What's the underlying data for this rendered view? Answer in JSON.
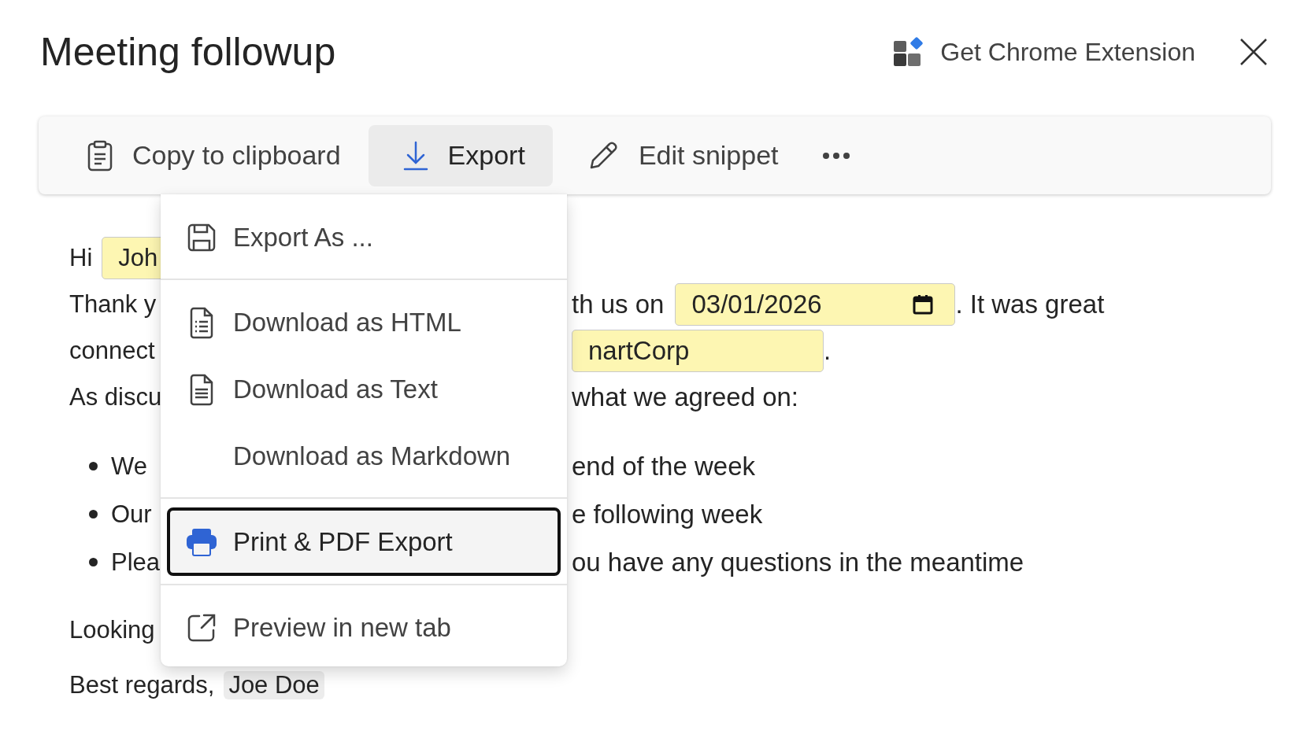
{
  "header": {
    "title": "Meeting followup",
    "extension_link": "Get Chrome Extension"
  },
  "toolbar": [
    {
      "kind": "clipboard",
      "label": "Copy to clipboard",
      "selected": false
    },
    {
      "kind": "export",
      "label": "Export",
      "selected": true
    },
    {
      "kind": "edit",
      "label": "Edit snippet",
      "selected": false
    },
    {
      "kind": "more",
      "selected": false
    }
  ],
  "export_menu": {
    "items": [
      {
        "kind": "save",
        "label": "Export As ...",
        "focused": false,
        "divider_after": true
      },
      {
        "kind": "html",
        "label": "Download as HTML",
        "focused": false,
        "divider_after": false
      },
      {
        "kind": "text",
        "label": "Download as Text",
        "focused": false,
        "divider_after": false
      },
      {
        "kind": "none",
        "label": "Download as Markdown",
        "focused": false,
        "divider_after": true
      },
      {
        "kind": "print",
        "label": "Print & PDF Export",
        "focused": true,
        "divider_after": true
      },
      {
        "kind": "external",
        "label": "Preview in new tab",
        "focused": false,
        "divider_after": false
      }
    ]
  },
  "body": [
    {
      "kind": "paragraph",
      "lines": [
        {
          "left": [
            {
              "kind": "text",
              "text": "Hi"
            },
            {
              "kind": "field",
              "value": "Joh"
            }
          ]
        },
        {
          "left": [
            {
              "kind": "text",
              "text": "Thank y"
            }
          ],
          "right": [
            {
              "kind": "text",
              "text": "th us on"
            },
            {
              "kind": "date",
              "value": "03/01/2026"
            },
            {
              "kind": "text",
              "text": ". It was great"
            }
          ]
        },
        {
          "left": [
            {
              "kind": "text",
              "text": "connect"
            }
          ],
          "right": [
            {
              "kind": "field",
              "value": "nartCorp"
            },
            {
              "kind": "text",
              "text": "."
            }
          ]
        },
        {
          "left": [
            {
              "kind": "text",
              "text": "As discu"
            }
          ],
          "right": [
            {
              "kind": "text",
              "text": "what we agreed on:"
            }
          ]
        }
      ]
    },
    {
      "kind": "list",
      "lines": [
        {
          "left": [
            {
              "kind": "text",
              "text": "We"
            }
          ],
          "right": [
            {
              "kind": "text",
              "text": "end of the week"
            }
          ]
        },
        {
          "left": [
            {
              "kind": "text",
              "text": "Our"
            }
          ],
          "right": [
            {
              "kind": "text",
              "text": "e following week"
            }
          ]
        },
        {
          "left": [
            {
              "kind": "text",
              "text": "Plea"
            }
          ],
          "right": [
            {
              "kind": "text",
              "text": "ou have any questions in the meantime"
            }
          ]
        }
      ]
    },
    {
      "kind": "closing",
      "lines": [
        {
          "left": [
            {
              "kind": "text",
              "text": "Looking"
            }
          ]
        },
        {
          "left": [
            {
              "kind": "text",
              "text": "Best regards,"
            },
            {
              "kind": "chip",
              "text": "Joe Doe"
            }
          ]
        }
      ]
    }
  ]
}
